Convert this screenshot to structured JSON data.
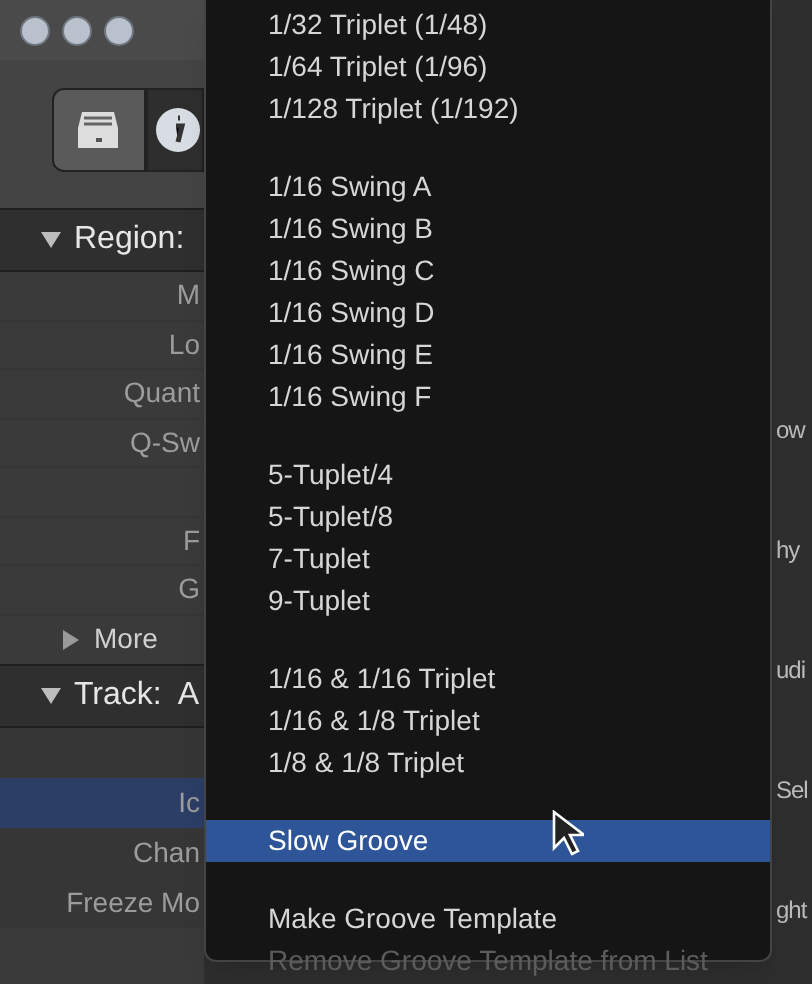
{
  "inspector": {
    "region_header": "Region:",
    "region_rows": [
      {
        "label": "M"
      },
      {
        "label": "Lo"
      },
      {
        "label": "Quant"
      },
      {
        "label": "Q-Sw"
      },
      {
        "label": ""
      },
      {
        "label": "F"
      },
      {
        "label": "G"
      }
    ],
    "more": {
      "label": "More",
      "expanded": false
    },
    "track_header": "Track:  A",
    "track_rows": [
      {
        "label": "",
        "selected": false
      },
      {
        "label": "Ic",
        "selected": true
      },
      {
        "label": "Chan",
        "selected": false
      },
      {
        "label": "Freeze Mo",
        "selected": false
      }
    ]
  },
  "right_fragments": [
    "ow",
    "hy",
    "udi",
    "Sel",
    "ght"
  ],
  "menu": [
    [
      {
        "label": "1/32 Triplet (1/48)",
        "selected": false,
        "disabled": false
      },
      {
        "label": "1/64 Triplet (1/96)",
        "selected": false,
        "disabled": false
      },
      {
        "label": "1/128 Triplet (1/192)",
        "selected": false,
        "disabled": false
      }
    ],
    [
      {
        "label": "1/16 Swing A",
        "selected": false,
        "disabled": false
      },
      {
        "label": "1/16 Swing B",
        "selected": false,
        "disabled": false
      },
      {
        "label": "1/16 Swing C",
        "selected": false,
        "disabled": false
      },
      {
        "label": "1/16 Swing D",
        "selected": false,
        "disabled": false
      },
      {
        "label": "1/16 Swing E",
        "selected": false,
        "disabled": false
      },
      {
        "label": "1/16 Swing F",
        "selected": false,
        "disabled": false
      }
    ],
    [
      {
        "label": "5-Tuplet/4",
        "selected": false,
        "disabled": false
      },
      {
        "label": "5-Tuplet/8",
        "selected": false,
        "disabled": false
      },
      {
        "label": "7-Tuplet",
        "selected": false,
        "disabled": false
      },
      {
        "label": "9-Tuplet",
        "selected": false,
        "disabled": false
      }
    ],
    [
      {
        "label": "1/16 & 1/16 Triplet",
        "selected": false,
        "disabled": false
      },
      {
        "label": "1/16 & 1/8 Triplet",
        "selected": false,
        "disabled": false
      },
      {
        "label": "1/8 & 1/8 Triplet",
        "selected": false,
        "disabled": false
      }
    ],
    [
      {
        "label": "Slow Groove",
        "selected": true,
        "disabled": false
      }
    ],
    [
      {
        "label": "Make Groove Template",
        "selected": false,
        "disabled": false
      },
      {
        "label": "Remove Groove Template from List",
        "selected": false,
        "disabled": true
      }
    ]
  ]
}
